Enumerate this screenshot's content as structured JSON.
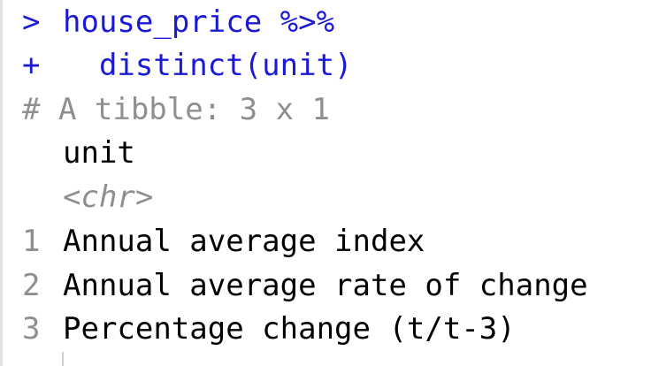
{
  "console": {
    "command": {
      "prompt": ">",
      "text": "house_price %>%",
      "continuation_prompt": "+",
      "continuation_text": "  distinct(unit)"
    },
    "output": {
      "tibble_header": "# A tibble: 3 x 1",
      "column_name": "unit",
      "column_type": "<chr>",
      "rows": [
        {
          "index": "1",
          "value": "Annual average index"
        },
        {
          "index": "2",
          "value": "Annual average rate of change"
        },
        {
          "index": "3",
          "value": "Percentage change (t/t-3)"
        }
      ]
    }
  }
}
